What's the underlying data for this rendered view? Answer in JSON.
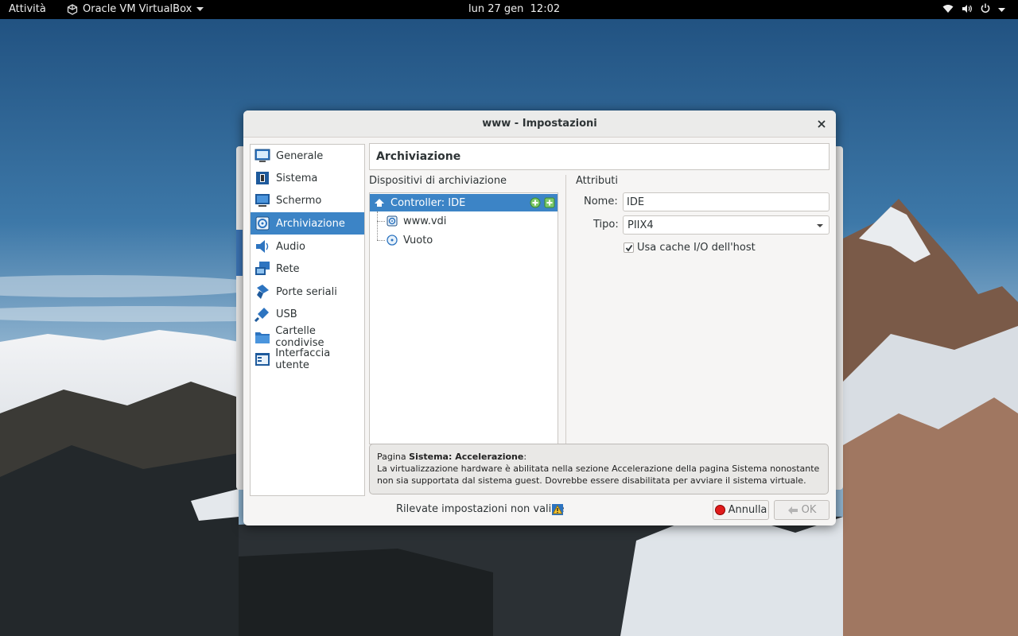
{
  "topbar": {
    "activities": "Attività",
    "app_name": "Oracle VM VirtualBox",
    "clock": "lun 27 gen  12:02",
    "tray_icons": [
      "wifi-icon",
      "volume-icon",
      "power-icon"
    ]
  },
  "dialog": {
    "title": "www - Impostazioni",
    "nav": [
      {
        "label": "Generale",
        "icon": "general-icon"
      },
      {
        "label": "Sistema",
        "icon": "system-icon"
      },
      {
        "label": "Schermo",
        "icon": "display-icon"
      },
      {
        "label": "Archiviazione",
        "icon": "storage-icon",
        "selected": true
      },
      {
        "label": "Audio",
        "icon": "audio-icon"
      },
      {
        "label": "Rete",
        "icon": "network-icon"
      },
      {
        "label": "Porte seriali",
        "icon": "serial-ports-icon"
      },
      {
        "label": "USB",
        "icon": "usb-icon"
      },
      {
        "label": "Cartelle condivise",
        "icon": "shared-folder-icon"
      },
      {
        "label": "Interfaccia utente",
        "icon": "user-interface-icon"
      }
    ],
    "page_header": "Archiviazione",
    "storage": {
      "label": "Dispositivi di archiviazione",
      "controller": "Controller: IDE",
      "devices": [
        {
          "label": "www.vdi",
          "icon": "hard-disk-icon"
        },
        {
          "label": "Vuoto",
          "icon": "optical-disc-icon"
        }
      ]
    },
    "attributes": {
      "label": "Attributi",
      "name_label": "Nome:",
      "name_value": "IDE",
      "type_label": "Tipo:",
      "type_value": "PIIX4",
      "cache_label": "Usa cache I/O dell'host",
      "cache_checked": true
    },
    "warning": {
      "prefix": "Pagina ",
      "bold": "Sistema: Accelerazione",
      "suffix": ":",
      "body": "La virtualizzazione hardware è abilitata nella sezione Accelerazione della pagina Sistema nonostante non sia supportata dal sistema guest. Dovrebbe essere disabilitata per avviare il sistema virtuale."
    },
    "invalid_settings": "Rilevate impostazioni non valide",
    "cancel_label": "Annulla",
    "ok_label": "OK"
  },
  "colors": {
    "selection": "#3c84c6",
    "topbar": "#000000",
    "dialog_bg": "#f6f5f4"
  }
}
